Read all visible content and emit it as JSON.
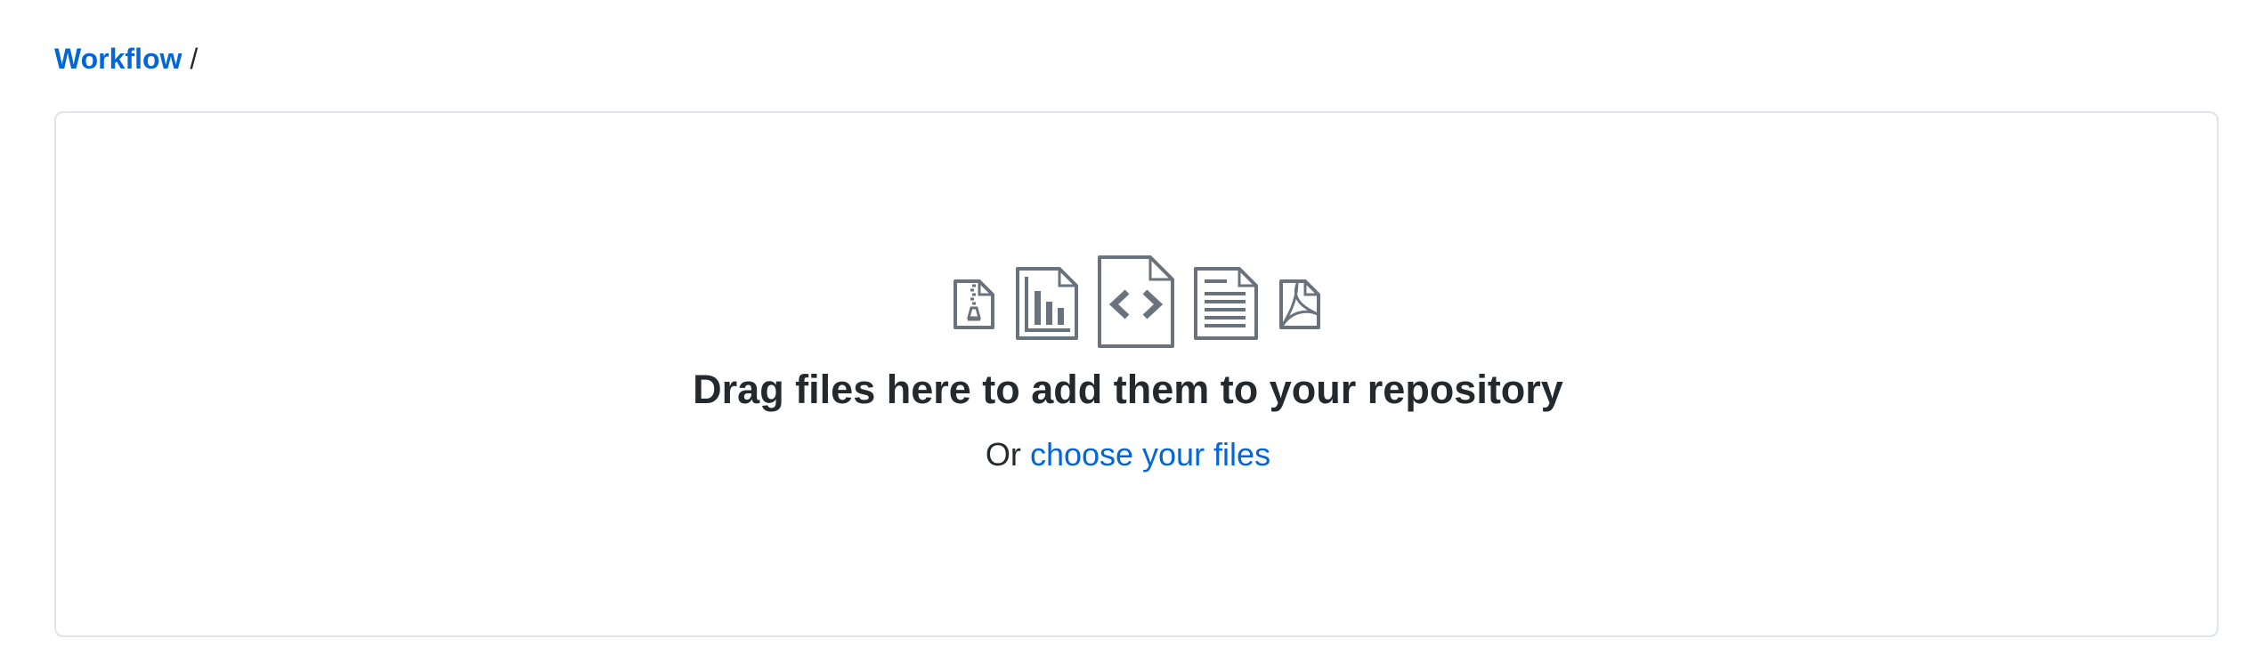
{
  "breadcrumb": {
    "repo_link": "Workflow",
    "separator": "/"
  },
  "upload": {
    "headline": "Drag files here to add them to your repository",
    "prefix": "Or",
    "choose_link": "choose your files",
    "icons": [
      "file-zip-icon",
      "graph-file-icon",
      "code-file-icon",
      "text-file-icon",
      "pdf-file-icon"
    ]
  },
  "colors": {
    "link": "#0366d6",
    "text": "#24292e",
    "border": "#e1e4e8",
    "icon": "#6a737d"
  }
}
